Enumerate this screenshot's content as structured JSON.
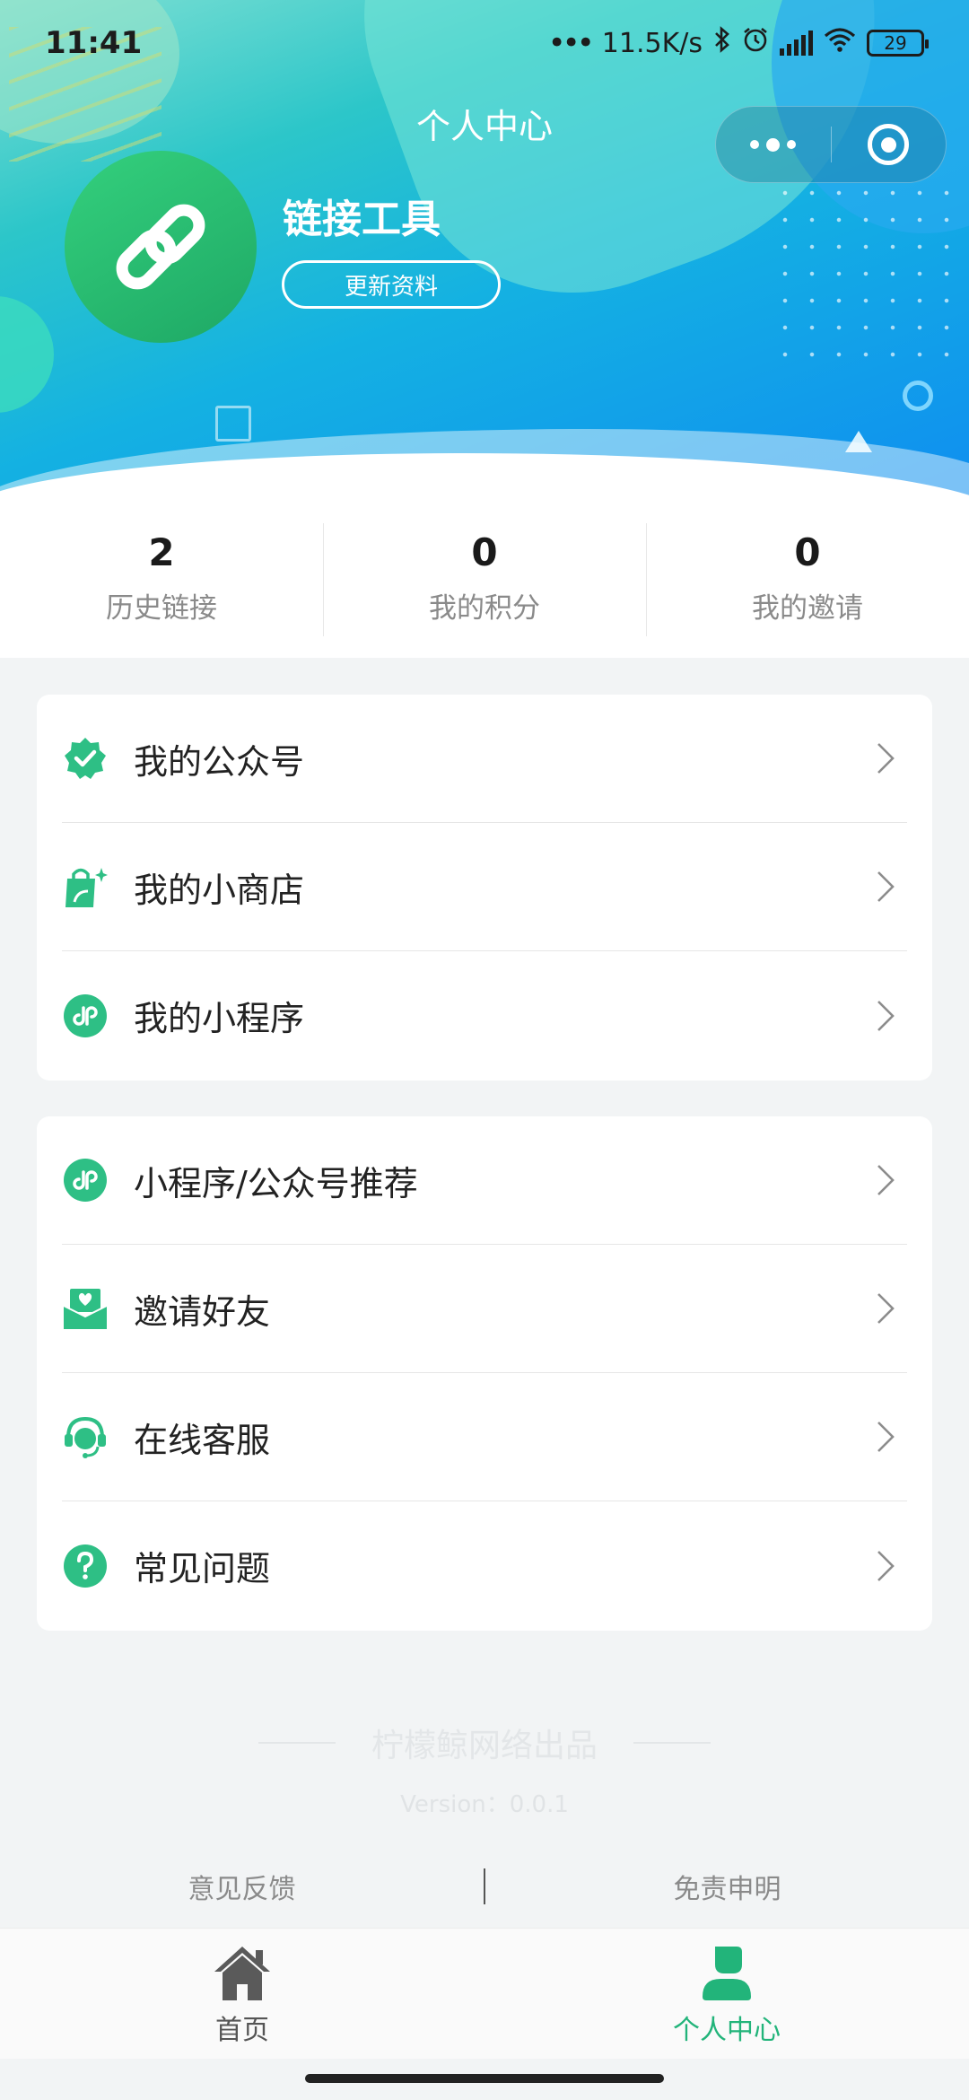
{
  "status_bar": {
    "time": "11:41",
    "net_speed": "11.5K/s",
    "battery": "29"
  },
  "nav": {
    "title": "个人中心"
  },
  "profile": {
    "name": "链接工具",
    "update_button": "更新资料"
  },
  "stats": [
    {
      "value": "2",
      "label": "历史链接"
    },
    {
      "value": "0",
      "label": "我的积分"
    },
    {
      "value": "0",
      "label": "我的邀请"
    }
  ],
  "menu_group1": [
    {
      "label": "我的公众号",
      "icon": "verified-badge-icon"
    },
    {
      "label": "我的小商店",
      "icon": "shopping-bag-icon"
    },
    {
      "label": "我的小程序",
      "icon": "mini-program-icon"
    }
  ],
  "menu_group2": [
    {
      "label": "小程序/公众号推荐",
      "icon": "mini-program-icon"
    },
    {
      "label": "邀请好友",
      "icon": "invite-envelope-icon"
    },
    {
      "label": "在线客服",
      "icon": "customer-service-icon"
    },
    {
      "label": "常见问题",
      "icon": "question-icon"
    }
  ],
  "footer": {
    "brand": "柠檬鲸网络出品",
    "version": "Version：0.0.1",
    "feedback": "意见反馈",
    "disclaimer": "免责申明"
  },
  "tabbar": {
    "home": "首页",
    "me": "个人中心"
  },
  "colors": {
    "accent": "#22b47a",
    "icon_green": "#2ebf85"
  }
}
